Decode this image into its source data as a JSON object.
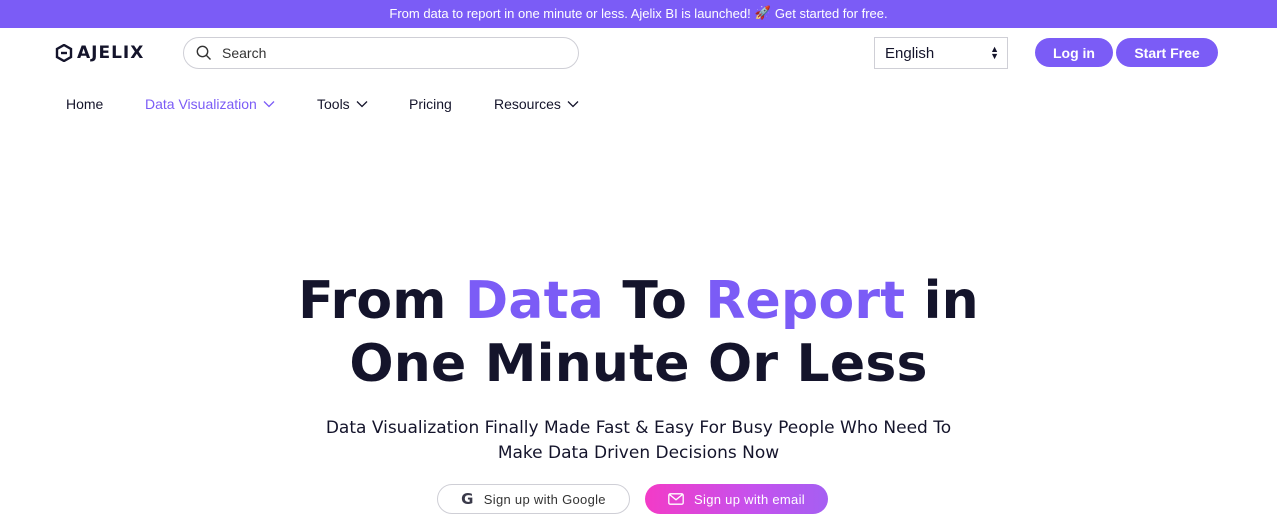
{
  "announcement": {
    "text_before": "From data to report in one minute or less. Ajelix BI is launched!",
    "emoji": "🚀",
    "text_after": "Get started for free."
  },
  "header": {
    "logo_text": "AJELIX",
    "search_placeholder": "Search",
    "language": "English",
    "login_label": "Log in",
    "start_label": "Start Free"
  },
  "nav": {
    "items": [
      {
        "label": "Home"
      },
      {
        "label": "Data Visualization"
      },
      {
        "label": "Tools"
      },
      {
        "label": "Pricing"
      },
      {
        "label": "Resources"
      }
    ]
  },
  "hero": {
    "title_parts": [
      "From ",
      "Data",
      " To ",
      "Report",
      " in",
      "One Minute Or Less"
    ],
    "subtitle_line1": "Data Visualization Finally Made Fast & Easy For Busy People Who Need To",
    "subtitle_line2": "Make Data Driven Decisions Now",
    "google_button": "Sign up with Google",
    "email_button": "Sign up with email"
  },
  "colors": {
    "brand": "#7b5cf6",
    "email_gradient_start": "#f33bc7",
    "text": "#14142b"
  }
}
